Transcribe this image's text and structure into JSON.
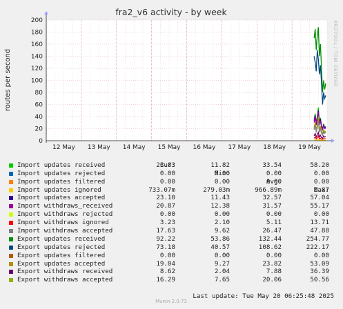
{
  "header": {
    "title": "fra2_v6 activity - by week",
    "ylabel": "routes per second",
    "side_text": "RRDTOOL / TOBI OETIKER",
    "footer": "Munin 2.0.73"
  },
  "legend": {
    "columns": [
      "Cur:",
      "Min:",
      "Avg:",
      "Max:"
    ],
    "rows": [
      {
        "label": "Import updates received",
        "color": "#00cc00",
        "cur": "23.83",
        "min": "11.82",
        "avg": "33.54",
        "max": "58.20"
      },
      {
        "label": "Import updates rejected",
        "color": "#0066b3",
        "cur": "0.00",
        "min": "0.00",
        "avg": "0.00",
        "max": "0.00"
      },
      {
        "label": "Import updates filtered",
        "color": "#ff8000",
        "cur": "0.00",
        "min": "0.00",
        "avg": "0.00",
        "max": "0.00"
      },
      {
        "label": "Import updates ignored",
        "color": "#ffcc00",
        "cur": "733.07m",
        "min": "279.03m",
        "avg": "966.89m",
        "max": "1.87"
      },
      {
        "label": "Import updates accepted",
        "color": "#330099",
        "cur": "23.10",
        "min": "11.43",
        "avg": "32.57",
        "max": "57.04"
      },
      {
        "label": "Import withdraws_received",
        "color": "#990099",
        "cur": "20.87",
        "min": "12.38",
        "avg": "31.57",
        "max": "55.17"
      },
      {
        "label": "Import withdraws rejected",
        "color": "#ccff00",
        "cur": "0.00",
        "min": "0.00",
        "avg": "0.00",
        "max": "0.00"
      },
      {
        "label": "Import withdraws ignored",
        "color": "#ff0000",
        "cur": "3.23",
        "min": "2.10",
        "avg": "5.11",
        "max": "13.71"
      },
      {
        "label": "Import withdraws accepted",
        "color": "#808080",
        "cur": "17.63",
        "min": "9.62",
        "avg": "26.47",
        "max": "47.88"
      },
      {
        "label": "Export updates received",
        "color": "#008f00",
        "cur": "92.22",
        "min": "53.86",
        "avg": "132.44",
        "max": "254.77"
      },
      {
        "label": "Export updates rejected",
        "color": "#00487d",
        "cur": "73.18",
        "min": "40.57",
        "avg": "108.62",
        "max": "222.17"
      },
      {
        "label": "Export updates filtered",
        "color": "#b35a00",
        "cur": "0.00",
        "min": "0.00",
        "avg": "0.00",
        "max": "0.00"
      },
      {
        "label": "Export updates accepted",
        "color": "#b38f00",
        "cur": "19.04",
        "min": "9.27",
        "avg": "23.82",
        "max": "53.09"
      },
      {
        "label": "Export withdraws received",
        "color": "#6b006b",
        "cur": "8.62",
        "min": "2.04",
        "avg": "7.88",
        "max": "36.39"
      },
      {
        "label": "Export withdraws accepted",
        "color": "#8fb300",
        "cur": "16.29",
        "min": "7.65",
        "avg": "20.06",
        "max": "50.56"
      }
    ],
    "last_update": "Last update: Tue May 20 06:25:48 2025"
  },
  "chart_data": {
    "type": "line",
    "title": "fra2_v6 activity - by week",
    "ylabel": "routes per second",
    "ylim": [
      0,
      200
    ],
    "yticks": [
      0,
      20,
      40,
      60,
      80,
      100,
      120,
      140,
      160,
      180,
      200
    ],
    "xticks": [
      "12 May",
      "13 May",
      "14 May",
      "15 May",
      "16 May",
      "17 May",
      "18 May",
      "19 May"
    ],
    "xlim": [
      0,
      8
    ],
    "grid": true,
    "series": [
      {
        "name": "Export updates received",
        "color": "#008f00",
        "x": [
          7.63,
          7.66,
          7.69,
          7.72,
          7.75,
          7.78,
          7.81,
          7.84,
          7.87,
          7.9,
          7.93,
          7.96
        ],
        "y": [
          170,
          185,
          150,
          175,
          188,
          140,
          160,
          120,
          80,
          100,
          85,
          95
        ]
      },
      {
        "name": "Export updates rejected",
        "color": "#00487d",
        "x": [
          7.63,
          7.66,
          7.69,
          7.72,
          7.75,
          7.78,
          7.81,
          7.84,
          7.87,
          7.9,
          7.93,
          7.96
        ],
        "y": [
          140,
          130,
          115,
          150,
          135,
          110,
          125,
          95,
          60,
          80,
          70,
          75
        ]
      },
      {
        "name": "Import updates received",
        "color": "#00cc00",
        "x": [
          7.63,
          7.66,
          7.69,
          7.72,
          7.75,
          7.78,
          7.81,
          7.84,
          7.87,
          7.9,
          7.93,
          7.96
        ],
        "y": [
          35,
          45,
          30,
          40,
          55,
          30,
          38,
          25,
          20,
          28,
          22,
          24
        ]
      },
      {
        "name": "Import updates accepted",
        "color": "#330099",
        "x": [
          7.63,
          7.66,
          7.69,
          7.72,
          7.75,
          7.78,
          7.81,
          7.84,
          7.87,
          7.9,
          7.93,
          7.96
        ],
        "y": [
          33,
          42,
          28,
          38,
          50,
          28,
          36,
          24,
          19,
          27,
          21,
          23
        ]
      },
      {
        "name": "Import withdraws_received",
        "color": "#990099",
        "x": [
          7.63,
          7.66,
          7.69,
          7.72,
          7.75,
          7.78,
          7.81,
          7.84,
          7.87,
          7.9,
          7.93,
          7.96
        ],
        "y": [
          30,
          40,
          26,
          36,
          48,
          26,
          33,
          22,
          18,
          25,
          20,
          21
        ]
      },
      {
        "name": "Export withdraws accepted",
        "color": "#8fb300",
        "x": [
          7.63,
          7.66,
          7.69,
          7.72,
          7.75,
          7.78,
          7.81,
          7.84,
          7.87,
          7.9,
          7.93,
          7.96
        ],
        "y": [
          22,
          30,
          18,
          26,
          40,
          18,
          24,
          15,
          12,
          18,
          15,
          16
        ]
      },
      {
        "name": "Export updates accepted",
        "color": "#b38f00",
        "x": [
          7.63,
          7.66,
          7.69,
          7.72,
          7.75,
          7.78,
          7.81,
          7.84,
          7.87,
          7.9,
          7.93,
          7.96
        ],
        "y": [
          20,
          28,
          16,
          24,
          36,
          16,
          22,
          14,
          10,
          16,
          14,
          15
        ]
      },
      {
        "name": "Export withdraws received",
        "color": "#6b006b",
        "x": [
          7.63,
          7.66,
          7.69,
          7.72,
          7.75,
          7.78,
          7.81,
          7.84,
          7.87,
          7.9,
          7.93,
          7.96
        ],
        "y": [
          8,
          12,
          6,
          10,
          14,
          6,
          9,
          5,
          4,
          8,
          6,
          7
        ]
      },
      {
        "name": "Import withdraws accepted",
        "color": "#808080",
        "x": [
          7.63,
          7.66,
          7.69,
          7.72,
          7.75,
          7.78,
          7.81,
          7.84,
          7.87,
          7.9,
          7.93,
          7.96
        ],
        "y": [
          18,
          26,
          14,
          22,
          32,
          14,
          20,
          12,
          9,
          15,
          12,
          14
        ]
      },
      {
        "name": "Import withdraws ignored",
        "color": "#ff0000",
        "x": [
          7.63,
          7.66,
          7.69,
          7.72,
          7.75,
          7.78,
          7.81,
          7.84,
          7.87,
          7.9,
          7.93,
          7.96
        ],
        "y": [
          4,
          6,
          3,
          5,
          8,
          3,
          4,
          2.5,
          2.2,
          3.5,
          3,
          3.2
        ]
      },
      {
        "name": "Import updates ignored",
        "color": "#ffcc00",
        "x": [
          7.63,
          7.66,
          7.69,
          7.72,
          7.75,
          7.78,
          7.81,
          7.84,
          7.87,
          7.9,
          7.93,
          7.96
        ],
        "y": [
          1,
          1.5,
          0.8,
          1.2,
          1.8,
          0.7,
          1,
          0.5,
          0.4,
          0.8,
          0.7,
          0.7
        ]
      }
    ]
  }
}
